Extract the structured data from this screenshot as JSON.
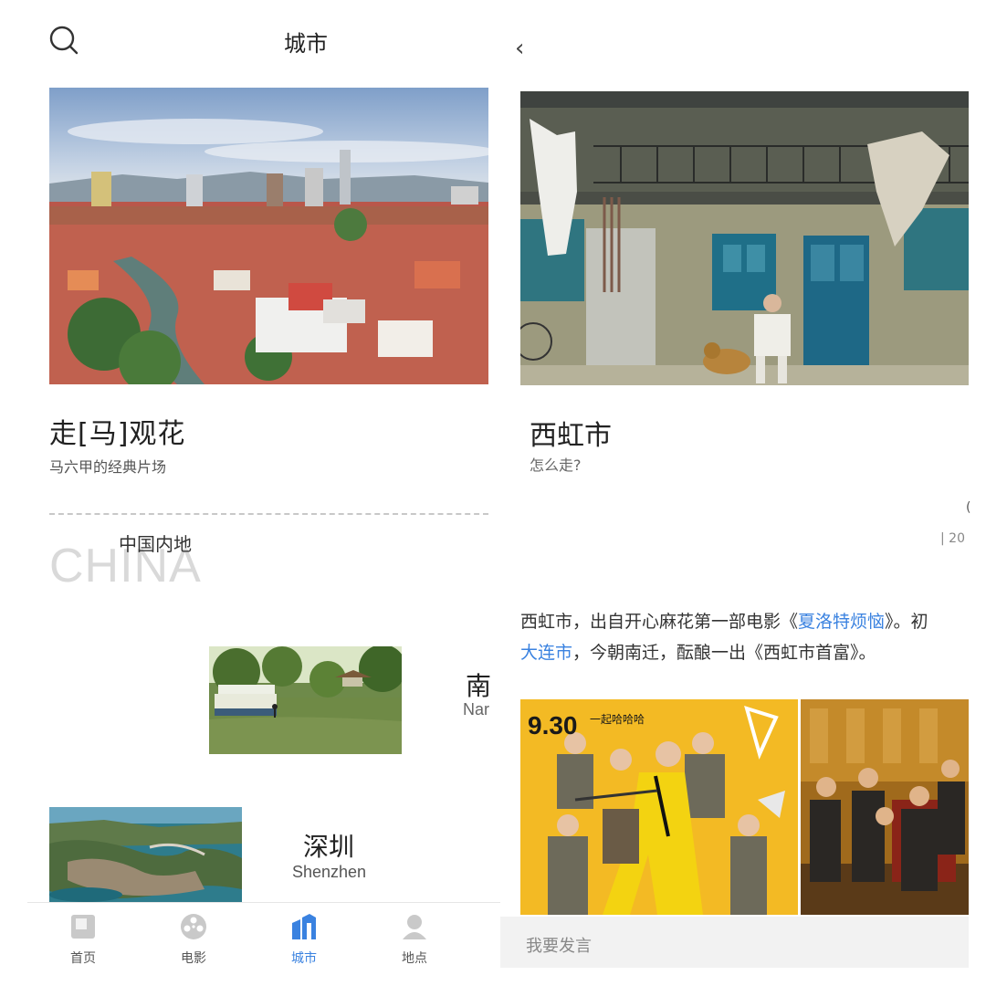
{
  "left": {
    "title": "城市",
    "hero": {
      "title": "走[马]观花",
      "subtitle": "马六甲的经典片场"
    },
    "section": {
      "bg_text": "CHINA",
      "label": "中国内地"
    },
    "cities": [
      {
        "cn": "南",
        "en": "Nar"
      },
      {
        "cn": "深圳",
        "en": "Shenzhen"
      }
    ],
    "tabs": [
      {
        "label": "首页",
        "icon": "home-icon"
      },
      {
        "label": "电影",
        "icon": "film-reel-icon"
      },
      {
        "label": "城市",
        "icon": "city-icon",
        "active": true
      },
      {
        "label": "地点",
        "icon": "location-person-icon"
      }
    ]
  },
  "right": {
    "back_icon": "‹",
    "title": "西虹市",
    "subtitle": "怎么走?",
    "edge_text_1": "(",
    "edge_text_2": "| 20",
    "desc": {
      "p1": "西虹市，出自开心麻花第一部电影《",
      "link1": "夏洛特烦恼",
      "p2": "》。初",
      "link2": "大连市",
      "p3": "，今朝南迁，酝酿一出《西虹市首富》。"
    },
    "poster_date": "9.30",
    "poster_tagline": "一起哈哈哈",
    "comment_placeholder": "我要发言"
  },
  "colors": {
    "accent": "#3a82e0",
    "separator": "#c8c8c8",
    "comment_bg": "#f2f2f2"
  }
}
